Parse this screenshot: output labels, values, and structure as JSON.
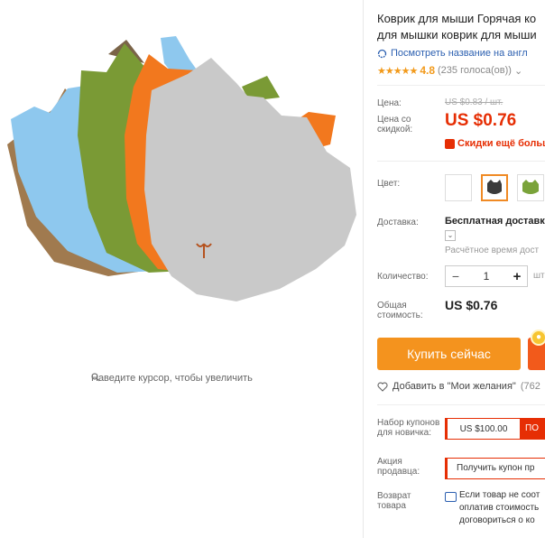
{
  "gallery": {
    "zoom_hint": "Наведите курсор, чтобы увеличить"
  },
  "product": {
    "title_line1": "Коврик для мыши Горячая ко",
    "title_line2": "для мышки коврик для мыши",
    "translate_link": "Посмотреть название на англ",
    "rating_stars": "★★★★★",
    "rating_value": "4.8",
    "votes": "(235 голоса(ов))"
  },
  "price": {
    "label": "Цена:",
    "old_value": "US $0.83 / шт.",
    "discount_label": "Цена со скидкой:",
    "new_value": "US $0.76",
    "promo_text": "Скидки ещё больш"
  },
  "color": {
    "label": "Цвет:",
    "swatches": [
      {
        "name": "white",
        "hex": "#ffffff",
        "selected": false
      },
      {
        "name": "black",
        "hex": "#3b3b3b",
        "selected": true
      },
      {
        "name": "green",
        "hex": "#7aa33a",
        "selected": false
      }
    ]
  },
  "shipping": {
    "label": "Доставка:",
    "value": "Бесплатная доставка",
    "toggle": "⌄",
    "estimate": "Расчётное время дост"
  },
  "quantity": {
    "label": "Количество:",
    "minus": "−",
    "value": "1",
    "plus": "+",
    "unit": "шт"
  },
  "total": {
    "label": "Общая стоимость:",
    "value": "US $0.76"
  },
  "actions": {
    "buy_label": "Купить сейчас",
    "wishlist_label": "Добавить в \"Мои желания\"",
    "wishlist_count": "(762"
  },
  "coupons": {
    "newbie_label": "Набор купонов для новичка:",
    "newbie_amount": "US $100.00",
    "newbie_get": "ПО",
    "seller_label": "Акция продавца:",
    "seller_get": "Получить купон пр"
  },
  "returns": {
    "label": "Возврат товара",
    "line1": "Если товар не соот",
    "line2": "оплатив стоимость",
    "line3": "договориться о ко"
  },
  "colors": {
    "accent": "#f4931e",
    "price_red": "#e62e04",
    "link_blue": "#2b5fb0"
  }
}
